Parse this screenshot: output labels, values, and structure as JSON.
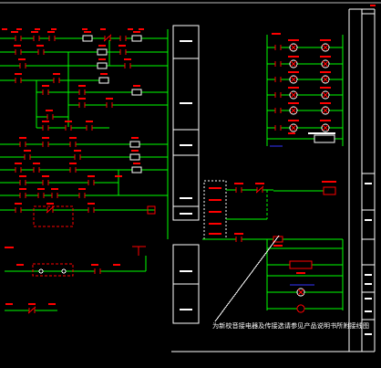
{
  "drawing": {
    "note": "为新校音接电器及传接选请参见产品说明书所附接线图"
  },
  "colors": {
    "background": "#000000",
    "wire": "#00ff00",
    "component": "#ff0000",
    "frame": "#ffffff",
    "accent": "#3333ff"
  }
}
